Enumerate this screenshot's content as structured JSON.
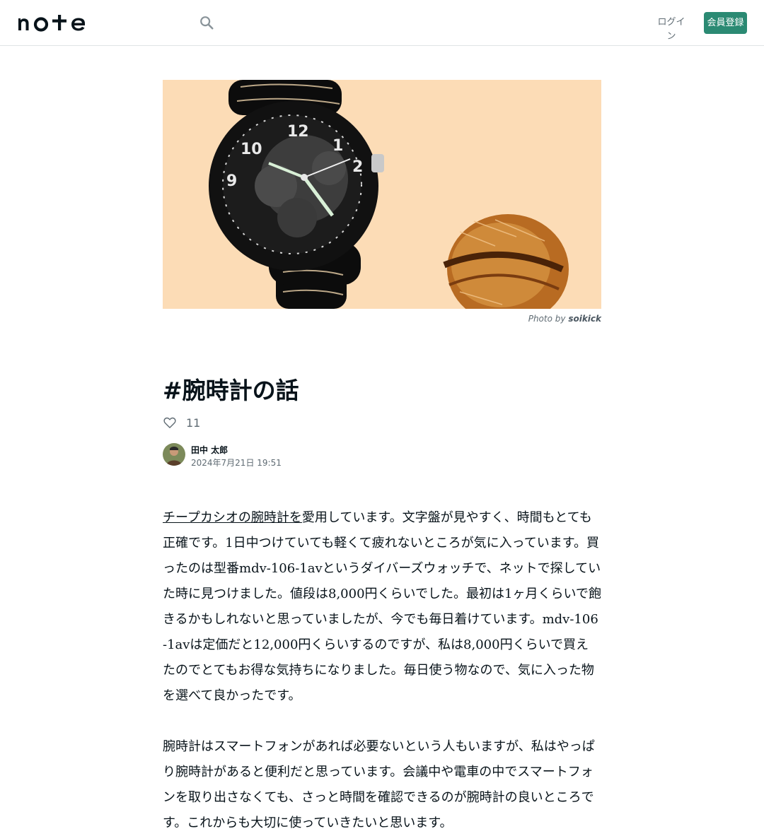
{
  "header": {
    "logo_text": "note",
    "login_label": "ログイン",
    "signup_label": "会員登録",
    "search_icon": "search-icon"
  },
  "hero": {
    "credit_prefix": "Photo by",
    "credit_author": "soikick",
    "background": "#fcdcb6"
  },
  "article": {
    "title": "#腕時計の話",
    "like_count": "11",
    "author_name": "田中 太郎",
    "date": "2024年7月21日 19:51",
    "paragraphs": [
      {
        "link_text": "チープカシオの腕時計を",
        "text": "愛用しています。文字盤が見やすく、時間もとても正確です。1日中つけていても軽くて疲れないところが気に入っています。買ったのは型番mdv-106-1avというダイバーズウォッチで、ネットで探していた時に見つけました。値段は8,000円くらいでした。最初は1ヶ月くらいで飽きるかもしれないと思っていましたが、今でも毎日着けています。mdv-106-1avは定価だと12,000円くらいするのですが、私は8,000円くらいで買えたのでとてもお得な気持ちになりました。毎日使う物なので、気に入った物を選べて良かったです。"
      },
      {
        "link_text": "",
        "text": "腕時計はスマートフォンがあれば必要ないという人もいますが、私はやっぱり腕時計があると便利だと思っています。会議中や電車の中でスマートフォンを取り出さなくても、さっと時間を確認できるのが腕時計の良いところです。これからも大切に使っていきたいと思います。"
      }
    ]
  },
  "colors": {
    "accent": "#2b8a73",
    "text": "#08131a",
    "muted": "#5f6b73"
  }
}
